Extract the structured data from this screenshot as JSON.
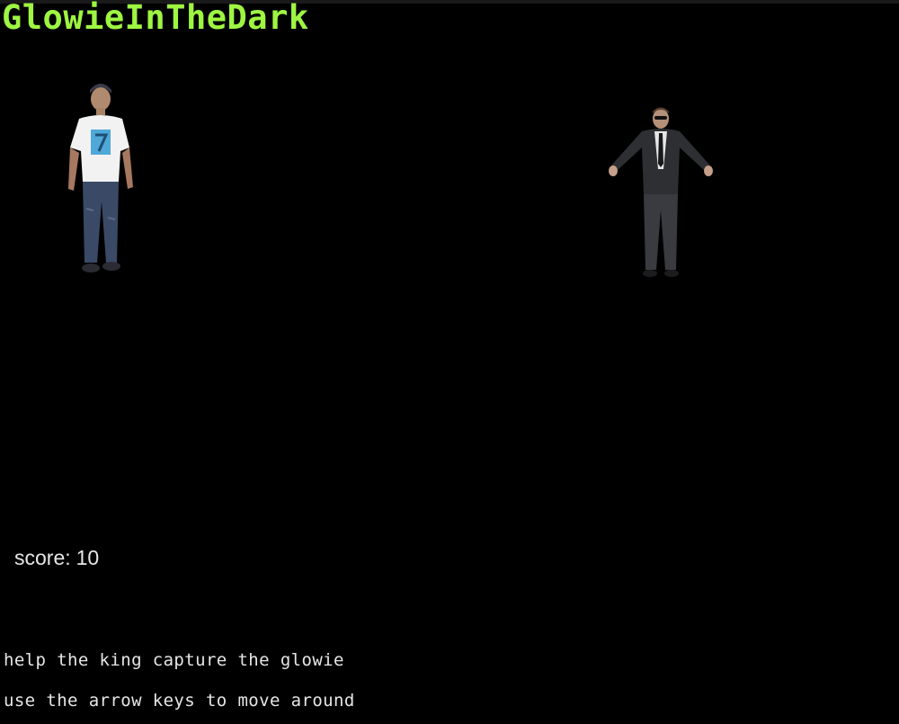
{
  "game": {
    "title": "GlowieInTheDark",
    "title_color": "#9ef542",
    "background": "#000000"
  },
  "sprites": {
    "player": {
      "name": "king",
      "description": "player character"
    },
    "enemy": {
      "name": "glowie",
      "description": "target character"
    }
  },
  "hud": {
    "score_label": "score:",
    "score_value": "10"
  },
  "instructions": {
    "line1": "help the king capture the glowie",
    "line2": "use the arrow keys to move around"
  }
}
